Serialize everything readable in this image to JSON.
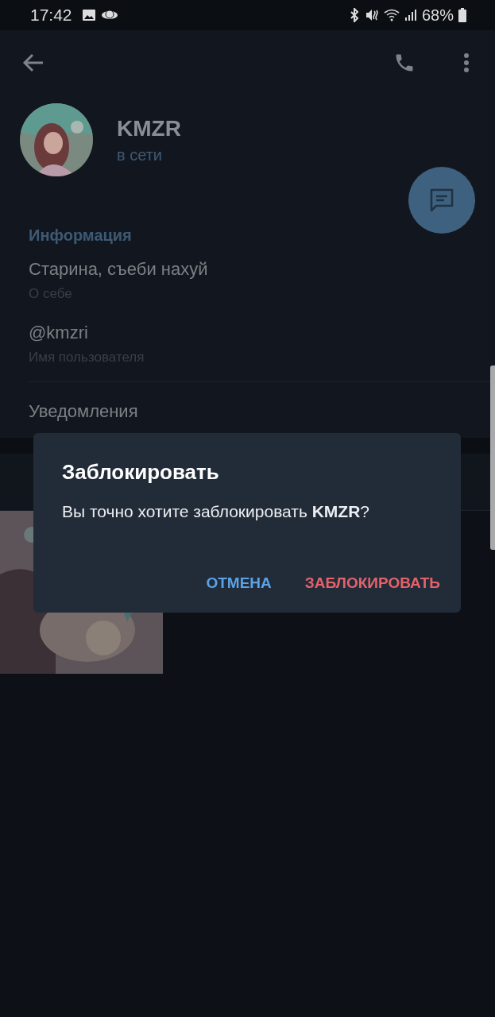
{
  "status_bar": {
    "time": "17:42",
    "battery": "68%"
  },
  "profile": {
    "name": "KMZR",
    "status": "в сети"
  },
  "info": {
    "title": "Информация",
    "rows": [
      {
        "value": "Старина, съеби нахуй",
        "label": "О себе"
      },
      {
        "value": "@kmzri",
        "label": "Имя пользователя"
      }
    ],
    "notifications": "Уведомления"
  },
  "dialog": {
    "title": "Заблокировать",
    "message": "Вы точно хотите заблокировать **KMZR**?",
    "buttons": [
      {
        "label": "ОТМЕНА",
        "kind": "neutral"
      },
      {
        "label": "ЗАБЛОКИРОВАТЬ",
        "kind": "danger"
      }
    ]
  }
}
